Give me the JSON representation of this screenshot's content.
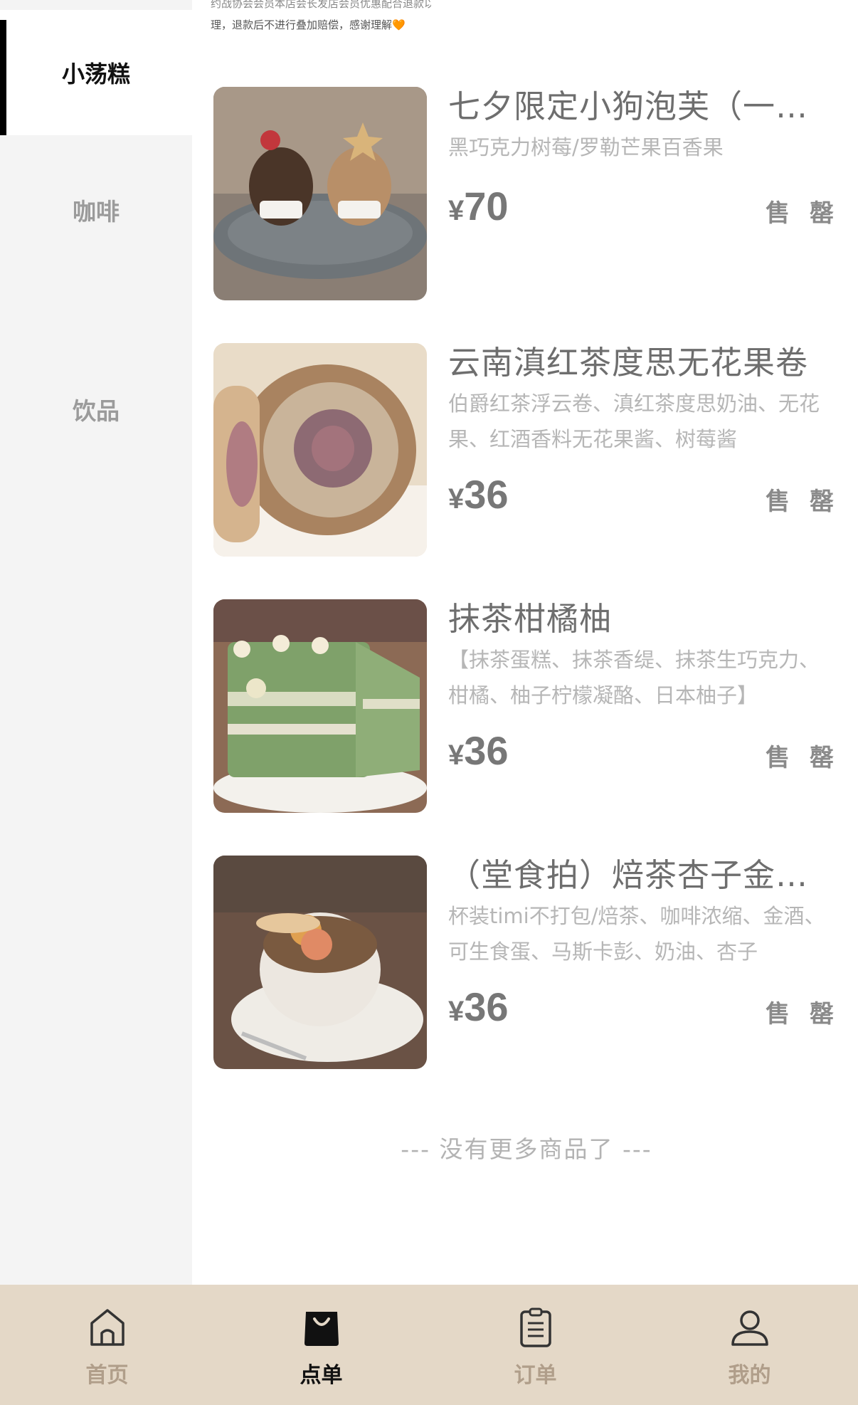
{
  "notice": {
    "line1": "约战协会会员本店会长发店会员优惠配合退款以",
    "line2": "理，退款后不进行叠加赔偿，感谢理解🧡"
  },
  "sidebar": {
    "items": [
      {
        "label": "小荡糕",
        "active": true
      },
      {
        "label": "咖啡",
        "active": false
      },
      {
        "label": "饮品",
        "active": false
      }
    ]
  },
  "products": [
    {
      "title": "七夕限定小狗泡芙（一对）",
      "desc": "黑巧克力树莓/罗勒芒果百香果",
      "currency": "¥",
      "price": "70",
      "status": "售 罄"
    },
    {
      "title": "云南滇红茶度思无花果卷",
      "desc": "伯爵红茶浮云卷、滇红茶度思奶油、无花果、红酒香料无花果酱、树莓酱",
      "currency": "¥",
      "price": "36",
      "status": "售 罄"
    },
    {
      "title": "抹茶柑橘柚",
      "desc": "【抹茶蛋糕、抹茶香缇、抹茶生巧克力、柑橘、柚子柠檬凝酪、日本柚子】",
      "currency": "¥",
      "price": "36",
      "status": "售 罄"
    },
    {
      "title": "（堂食拍）焙茶杏子金酒提拉米苏",
      "desc": "杯装timi不打包/焙茶、咖啡浓缩、金酒、可生食蛋、马斯卡彭、奶油、杏子",
      "currency": "¥",
      "price": "36",
      "status": "售 罄"
    }
  ],
  "end_tip": "--- 没有更多商品了 ---",
  "tabbar": {
    "items": [
      {
        "label": "首页",
        "icon": "home-icon",
        "active": false
      },
      {
        "label": "点单",
        "icon": "shopping-bag-icon",
        "active": true
      },
      {
        "label": "订单",
        "icon": "clipboard-icon",
        "active": false
      },
      {
        "label": "我的",
        "icon": "user-icon",
        "active": false
      }
    ]
  },
  "colors": {
    "tabbar_bg": "#e4d8c7",
    "sidebar_bg": "#f4f4f4",
    "active_indicator": "#000000"
  }
}
